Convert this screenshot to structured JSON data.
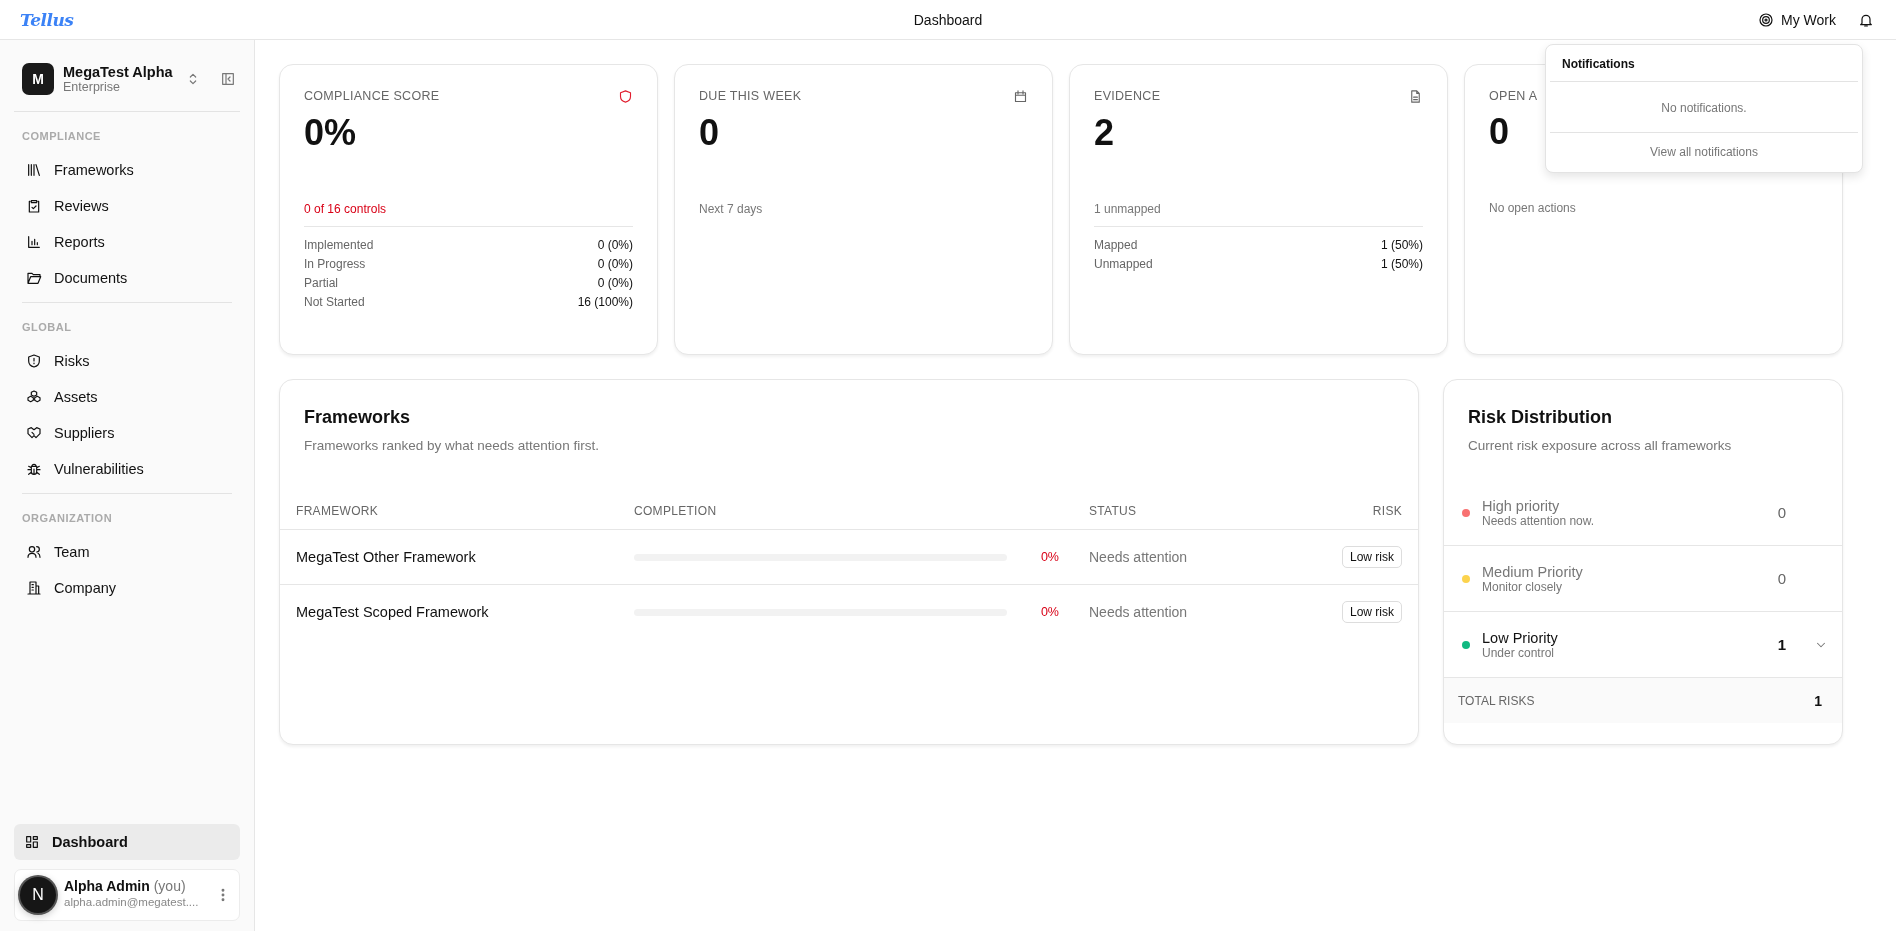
{
  "header": {
    "logo": "Tellus",
    "title": "Dashboard",
    "my_work": "My Work"
  },
  "sidebar": {
    "org": {
      "initial": "M",
      "name": "MegaTest Alpha",
      "plan": "Enterprise"
    },
    "sections": [
      {
        "label": "COMPLIANCE",
        "items": [
          {
            "label": "Frameworks",
            "selected": false
          },
          {
            "label": "Reviews",
            "selected": false
          },
          {
            "label": "Reports",
            "selected": false
          },
          {
            "label": "Documents",
            "selected": false
          }
        ]
      },
      {
        "label": "GLOBAL",
        "items": [
          {
            "label": "Risks",
            "selected": false
          },
          {
            "label": "Assets",
            "selected": false
          },
          {
            "label": "Suppliers",
            "selected": false
          },
          {
            "label": "Vulnerabilities",
            "selected": false
          }
        ]
      },
      {
        "label": "ORGANIZATION",
        "items": [
          {
            "label": "Team",
            "selected": false
          },
          {
            "label": "Company",
            "selected": false
          }
        ]
      }
    ],
    "bottom_item": {
      "label": "Dashboard",
      "selected": true
    },
    "user": {
      "name": "Alpha Admin",
      "suffix": "(you)",
      "email": "alpha.admin@megatest....",
      "avatar": "N"
    }
  },
  "cards": [
    {
      "title": "COMPLIANCE SCORE",
      "value": "0%",
      "note": "0 of 16 controls",
      "alert": true,
      "stats": [
        {
          "label": "Implemented",
          "value": "0 (0%)"
        },
        {
          "label": "In Progress",
          "value": "0 (0%)"
        },
        {
          "label": "Partial",
          "value": "0 (0%)"
        },
        {
          "label": "Not Started",
          "value": "16 (100%)"
        }
      ]
    },
    {
      "title": "DUE THIS WEEK",
      "value": "0",
      "note": "Next 7 days",
      "alert": false
    },
    {
      "title": "EVIDENCE",
      "value": "2",
      "note": "1 unmapped",
      "alert": false,
      "stats": [
        {
          "label": "Mapped",
          "value": "1 (50%)"
        },
        {
          "label": "Unmapped",
          "value": "1 (50%)"
        }
      ]
    },
    {
      "title": "OPEN A",
      "value": "0",
      "note": "No open actions",
      "alert": false
    }
  ],
  "notifications": {
    "title": "Notifications",
    "empty": "No notifications.",
    "link": "View all notifications"
  },
  "frameworks": {
    "title": "Frameworks",
    "subtitle": "Frameworks ranked by what needs attention first.",
    "columns": [
      "FRAMEWORK",
      "COMPLETION",
      "STATUS",
      "RISK"
    ],
    "rows": [
      {
        "name": "MegaTest Other Framework",
        "level": 0,
        "percent": "0%",
        "status": "Needs attention",
        "risk": "Low risk"
      },
      {
        "name": "MegaTest Scoped Framework",
        "level": 0,
        "percent": "0%",
        "status": "Needs attention",
        "risk": "Low risk"
      }
    ]
  },
  "risk_distribution": {
    "title": "Risk Distribution",
    "subtitle": "Current risk exposure across all frameworks",
    "rows": [
      {
        "label": "High priority",
        "note": "Needs attention now.",
        "count": "0",
        "color": "#f87171",
        "muted": true,
        "expandable": false
      },
      {
        "label": "Medium Priority",
        "note": "Monitor closely",
        "count": "0",
        "color": "#fcd34d",
        "muted": true,
        "expandable": false
      },
      {
        "label": "Low Priority",
        "note": "Under control",
        "count": "1",
        "color": "#10b981",
        "muted": false,
        "expandable": true
      }
    ],
    "total_label": "TOTAL RISKS",
    "total": "1"
  }
}
